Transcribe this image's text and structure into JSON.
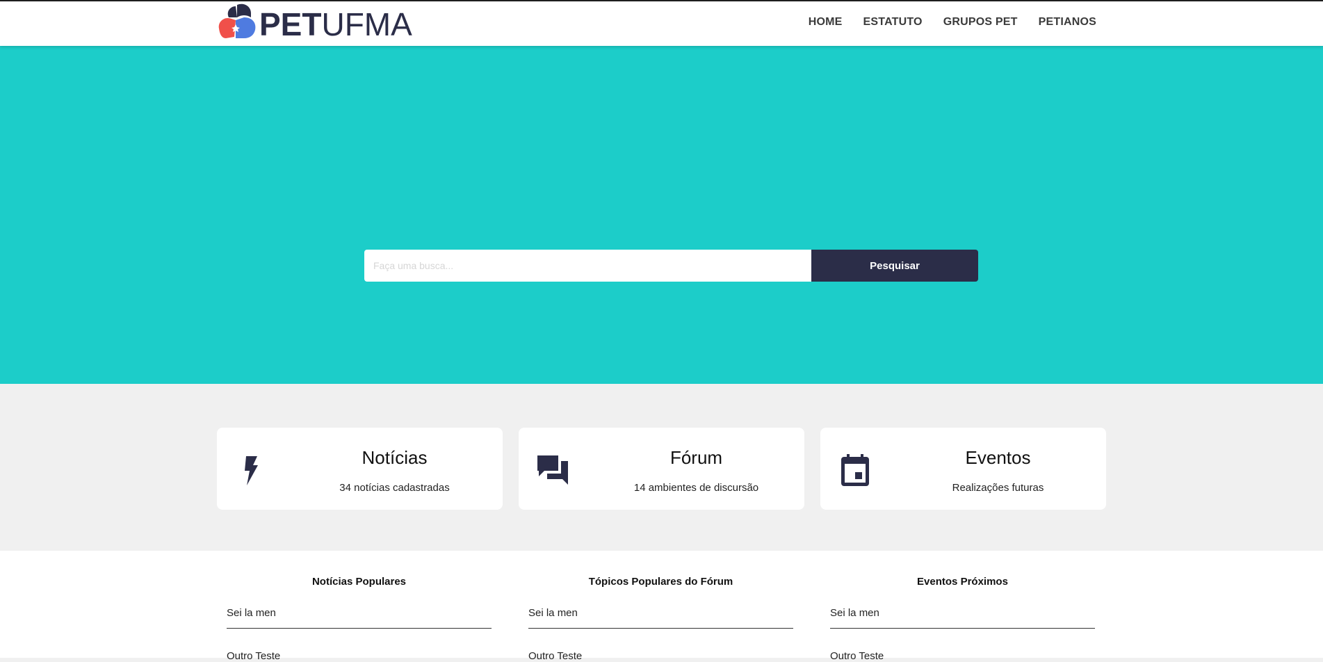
{
  "header": {
    "brand_bold": "PET",
    "brand_light": "UFMA",
    "nav": [
      "HOME",
      "ESTATUTO",
      "GRUPOS PET",
      "PETIANOS"
    ]
  },
  "hero": {
    "search_placeholder": "Faça uma busca...",
    "search_button": "Pesquisar",
    "color": "#1ccdc9"
  },
  "cards": [
    {
      "icon": "lightning-icon",
      "title": "Notícias",
      "subtitle": "34 notícias cadastradas"
    },
    {
      "icon": "forum-icon",
      "title": "Fórum",
      "subtitle": "14 ambientes de discursão"
    },
    {
      "icon": "calendar-icon",
      "title": "Eventos",
      "subtitle": "Realizações futuras"
    }
  ],
  "lists": [
    {
      "title": "Notícias Populares",
      "items": [
        "Sei la men",
        "Outro Teste"
      ]
    },
    {
      "title": "Tópicos Populares do Fórum",
      "items": [
        "Sei la men",
        "Outro Teste"
      ]
    },
    {
      "title": "Eventos Próximos",
      "items": [
        "Sei la men",
        "Outro Teste"
      ]
    }
  ],
  "colors": {
    "accent_dark": "#2b2d48",
    "logo_red": "#f0504a",
    "logo_blue": "#4f7be0"
  }
}
